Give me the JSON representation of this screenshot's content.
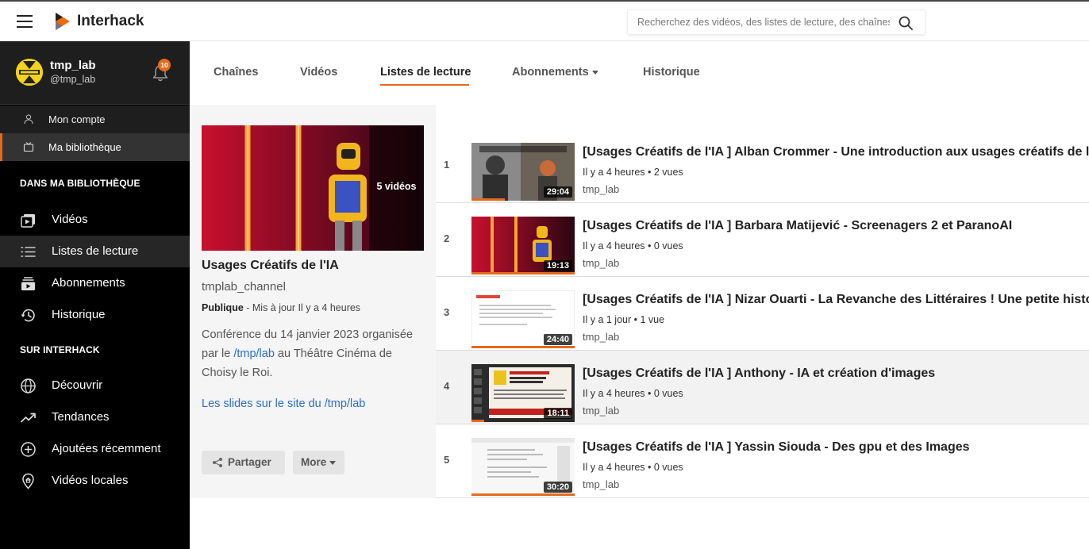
{
  "header": {
    "brand": "Interhack",
    "search_placeholder": "Recherchez des vidéos, des listes de lecture, des chaînes..."
  },
  "user": {
    "name": "tmp_lab",
    "handle": "@tmp_lab",
    "notifications": "10"
  },
  "sidebar": {
    "account_items": [
      {
        "label": "Mon compte",
        "icon": "user-icon"
      },
      {
        "label": "Ma bibliothèque",
        "icon": "library-icon",
        "active": true
      }
    ],
    "library_title": "DANS MA BIBLIOTHÈQUE",
    "library_items": [
      {
        "label": "Vidéos",
        "icon": "video-icon"
      },
      {
        "label": "Listes de lecture",
        "icon": "list-icon",
        "active": true
      },
      {
        "label": "Abonnements",
        "icon": "subscriptions-icon"
      },
      {
        "label": "Historique",
        "icon": "history-icon"
      }
    ],
    "site_title": "SUR INTERHACK",
    "site_items": [
      {
        "label": "Découvrir",
        "icon": "globe-icon"
      },
      {
        "label": "Tendances",
        "icon": "trending-icon"
      },
      {
        "label": "Ajoutées récemment",
        "icon": "plus-circle-icon"
      },
      {
        "label": "Vidéos locales",
        "icon": "location-icon"
      }
    ]
  },
  "tabs": [
    {
      "label": "Chaînes"
    },
    {
      "label": "Vidéos"
    },
    {
      "label": "Listes de lecture",
      "active": true
    },
    {
      "label": "Abonnements",
      "dropdown": true
    },
    {
      "label": "Historique"
    }
  ],
  "playlist": {
    "video_count": "5 vidéos",
    "title": "Usages Créatifs de l'IA",
    "channel": "tmplab_channel",
    "privacy": "Publique",
    "updated": " - Mis à jour Il y a 4 heures",
    "desc_before": "Conférence du 14 janvier 2023 organisée par le ",
    "desc_link": "/tmp/lab",
    "desc_after": " au Théâtre Cinéma de Choisy le Roi.",
    "slides_link": "Les slides sur le site du /tmp/lab",
    "share_label": "Partager",
    "more_label": "More"
  },
  "videos": [
    {
      "num": "1",
      "title": "[Usages Créatifs de l'IA ] Alban Crommer - Une introduction aux usages créatifs de l'IA",
      "meta": "Il y a 4 heures • 2 vues",
      "channel": "tmp_lab",
      "duration": "29:04",
      "progress": 0.32
    },
    {
      "num": "2",
      "title": "[Usages Créatifs de l'IA ] Barbara Matijević - Screenagers 2 et ParanoAI",
      "meta": "Il y a 4 heures • 0 vues",
      "channel": "tmp_lab",
      "duration": "19:13",
      "progress": 1.0
    },
    {
      "num": "3",
      "title": "[Usages Créatifs de l'IA ] Nizar Ouarti - La Revanche des Littéraires ! Une petite histoire",
      "meta": "Il y a 1 jour • 1 vue",
      "channel": "tmp_lab",
      "duration": "24:40",
      "progress": 1.0
    },
    {
      "num": "4",
      "title": "[Usages Créatifs de l'IA ] Anthony - IA et création d'images",
      "meta": "Il y a 4 heures • 0 vues",
      "channel": "tmp_lab",
      "duration": "18:11",
      "progress": 0.12
    },
    {
      "num": "5",
      "title": "[Usages Créatifs de l'IA ] Yassin Siouda - Des gpu et des Images",
      "meta": "Il y a 4 heures • 0 vues",
      "channel": "tmp_lab",
      "duration": "30:20",
      "progress": 1.0
    }
  ],
  "colors": {
    "accent": "#e56a1e",
    "link": "#2a6ec7",
    "sidebar": "#000000"
  }
}
